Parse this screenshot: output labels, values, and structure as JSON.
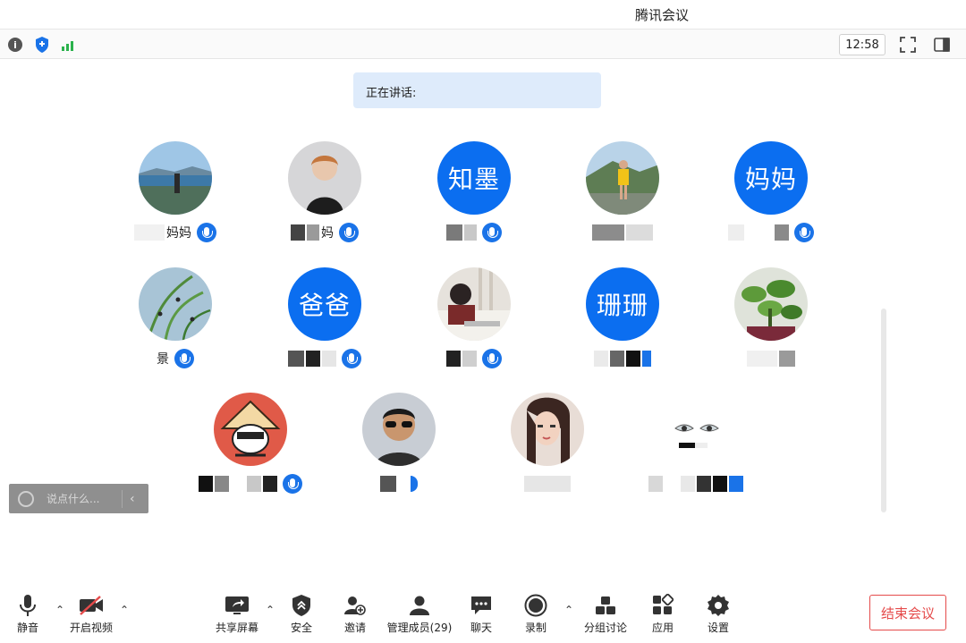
{
  "window": {
    "title": "腾讯会议"
  },
  "toolbar": {
    "clock": "12:58",
    "icons": [
      "info-icon",
      "shield-icon",
      "signal-icon",
      "fullscreen-icon",
      "panel-icon"
    ]
  },
  "speaking": {
    "label": "正在讲话:"
  },
  "participants": [
    {
      "name_text": "妈妈",
      "avatar": "photo-seaside"
    },
    {
      "name_text": "妈",
      "avatar": "photo-woman"
    },
    {
      "name_text": "",
      "avatar_text": "知墨"
    },
    {
      "name_text": "",
      "avatar": "photo-girl-yellow"
    },
    {
      "name_text": "",
      "avatar_text": "妈妈"
    },
    {
      "name_text": "景",
      "avatar": "photo-grass"
    },
    {
      "name_text": "",
      "avatar_text": "爸爸"
    },
    {
      "name_text": "",
      "avatar": "photo-child-study"
    },
    {
      "name_text": "",
      "avatar_text": "珊珊"
    },
    {
      "name_text": "",
      "avatar": "photo-plant"
    },
    {
      "name_text": "",
      "avatar": "photo-cartoon-hat"
    },
    {
      "name_text": "",
      "avatar": "photo-man-sunglasses"
    },
    {
      "name_text": "",
      "avatar": "photo-woman-selfie"
    },
    {
      "name_text": "",
      "avatar": "photo-eyes-sketch"
    }
  ],
  "chat": {
    "placeholder": "说点什么..."
  },
  "bottom_bar": {
    "mute": "静音",
    "video": "开启视频",
    "share": "共享屏幕",
    "security": "安全",
    "invite": "邀请",
    "members": "管理成员(29)",
    "chat": "聊天",
    "record": "录制",
    "breakout": "分组讨论",
    "apps": "应用",
    "settings": "设置",
    "end": "结束会议"
  },
  "colors": {
    "accent": "#0b6ef0",
    "end": "#e54b4b",
    "speaking_bg": "#deebfb"
  }
}
